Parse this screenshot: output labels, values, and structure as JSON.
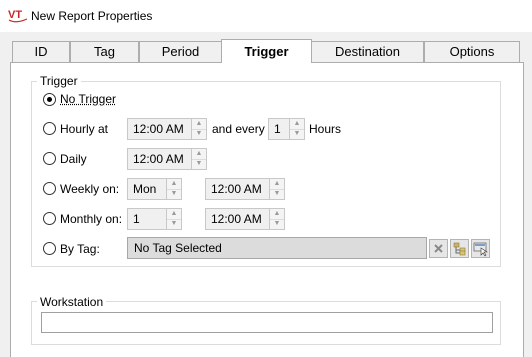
{
  "window": {
    "title": "New Report Properties"
  },
  "tabs": [
    {
      "label": "ID",
      "active": false
    },
    {
      "label": "Tag",
      "active": false
    },
    {
      "label": "Period",
      "active": false
    },
    {
      "label": "Trigger",
      "active": true
    },
    {
      "label": "Destination",
      "active": false
    },
    {
      "label": "Options",
      "active": false
    }
  ],
  "trigger_group": {
    "label": "Trigger",
    "options": {
      "no_trigger": {
        "label": "No Trigger",
        "checked": true
      },
      "hourly": {
        "label": "Hourly at",
        "time": "12:00 AM",
        "and_every": "and every",
        "interval": "1",
        "unit": "Hours"
      },
      "daily": {
        "label": "Daily",
        "time": "12:00 AM"
      },
      "weekly": {
        "label": "Weekly on:",
        "day": "Mon",
        "time": "12:00 AM"
      },
      "monthly": {
        "label": "Monthly on:",
        "day": "1",
        "time": "12:00 AM"
      },
      "by_tag": {
        "label": "By Tag:",
        "value": "No Tag Selected"
      }
    }
  },
  "workstation_group": {
    "label": "Workstation",
    "value": ""
  },
  "icons": {
    "clear": "close-icon",
    "tree": "tag-tree-icon",
    "browse": "tag-browse-icon"
  }
}
